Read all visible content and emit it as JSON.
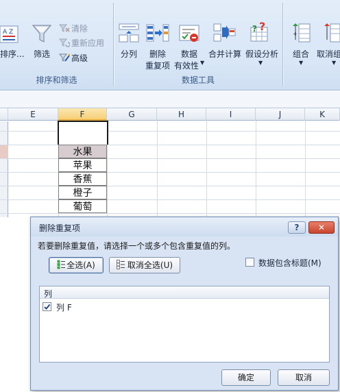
{
  "ribbon": {
    "sort_label": "排序...",
    "filter_label": "筛选",
    "clear_label": "清除",
    "reapply_label": "重新应用",
    "advanced_label": "高级",
    "sort_filter_group": "排序和筛选",
    "split_label": "分列",
    "remove_dup_label_1": "删除",
    "remove_dup_label_2": "重复项",
    "validation_label_1": "数据",
    "validation_label_2": "有效性",
    "consolidate_label": "合并计算",
    "whatif_label": "假设分析",
    "data_tools_group": "数据工具",
    "group_label": "组合",
    "ungroup_label": "取消组",
    "sort_icon_letters": "A Z"
  },
  "grid": {
    "columns": [
      "E",
      "F",
      "G",
      "H",
      "I",
      "J",
      "K"
    ],
    "selected_column": "F",
    "cells": [
      "水果",
      "苹果",
      "香蕉",
      "橙子",
      "葡萄"
    ]
  },
  "dialog": {
    "title": "删除重复项",
    "help_label": "?",
    "close_label": "✕",
    "instruction": "若要删除重复值，请选择一个或多个包含重复值的列。",
    "select_all_label": "全选(A)",
    "unselect_all_label": "取消全选(U)",
    "has_headers_label": "数据包含标题(M)",
    "list_header": "列",
    "column_items": [
      {
        "label": "列 F",
        "checked": true
      }
    ],
    "ok_label": "确定",
    "cancel_label": "取消"
  },
  "colors": {
    "ribbon_bg": "#dbe7f6",
    "selected_col": "#f6cf77",
    "close_red": "#c9452e"
  }
}
